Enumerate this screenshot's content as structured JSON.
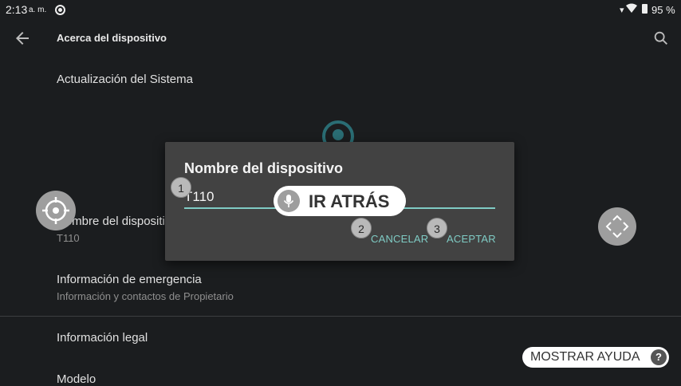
{
  "status_bar": {
    "time": "2:13",
    "ampm": "a. m.",
    "battery": "95 %"
  },
  "toolbar": {
    "title": "Acerca del dispositivo"
  },
  "list": [
    {
      "title": "Actualización del Sistema"
    },
    {
      "title": "Nombre del dispositivo",
      "subtitle": "T110"
    },
    {
      "title": "Información de emergencia",
      "subtitle": "Información y contactos de Propietario"
    },
    {
      "title": "Información legal"
    },
    {
      "title": "Modelo"
    }
  ],
  "dialog": {
    "title": "Nombre del dispositivo",
    "input_value": "T110",
    "cancel_label": "CANCELAR",
    "accept_label": "ACEPTAR"
  },
  "overlay": {
    "badges": [
      "1",
      "2",
      "3"
    ],
    "voice_command": "IR ATRÁS",
    "help_label": "MOSTRAR AYUDA",
    "help_icon": "?"
  },
  "colors": {
    "accent": "#7fcbc4",
    "background": "#1b1d1f",
    "dialog": "#424242"
  }
}
